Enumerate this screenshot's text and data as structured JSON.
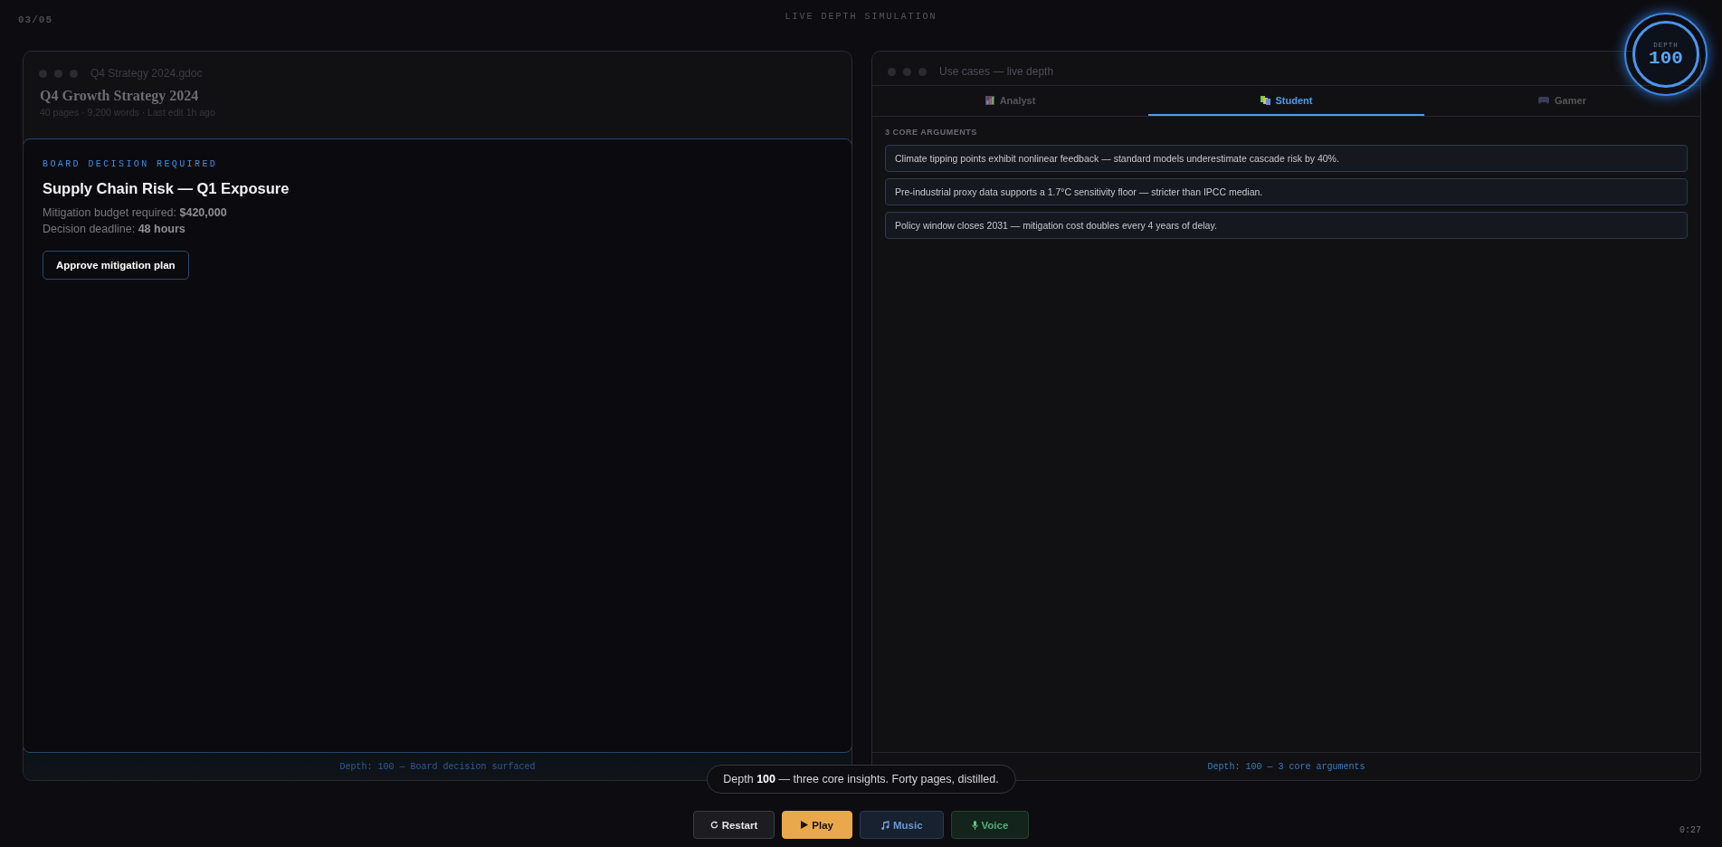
{
  "slide_counter": "03/05",
  "title": "LIVE DEPTH SIMULATION",
  "depth_badge": {
    "label": "DEPTH",
    "value": "100"
  },
  "left_window": {
    "filename": "Q4 Strategy 2024.gdoc",
    "doc_title": "Q4 Growth Strategy 2024",
    "meta": "40 pages · 9,200 words · Last edit 1h ago",
    "decision_card": {
      "eyebrow": "BOARD DECISION REQUIRED",
      "title": "Supply Chain Risk — Q1 Exposure",
      "lines": [
        "Mitigation budget required: **$420,000**",
        "Decision deadline: **48 hours**"
      ],
      "button": "Approve mitigation plan"
    },
    "footer": "Depth: 100 — Board decision surfaced"
  },
  "right_window": {
    "title": "Use cases — live depth",
    "tabs": [
      {
        "label": "Analyst",
        "kind": "chart",
        "selected": false
      },
      {
        "label": "Student",
        "kind": "books",
        "selected": true
      },
      {
        "label": "Gamer",
        "kind": "gamepad",
        "selected": false
      }
    ],
    "section_label": "3 CORE ARGUMENTS",
    "arguments": [
      "Climate tipping points exhibit nonlinear feedback — standard models underestimate cascade risk by 40%.",
      "Pre-industrial proxy data supports a 1.7°C sensitivity floor — stricter than IPCC median.",
      "Policy window closes 2031 — mitigation cost doubles every 4 years of delay."
    ],
    "footer": "Depth: 100 — 3 core arguments"
  },
  "caption": "Depth **100** — three core insights. Forty pages, distilled.",
  "controls": [
    {
      "label": "Restart",
      "kind": "restart"
    },
    {
      "label": "Play",
      "kind": "play"
    },
    {
      "label": "Music",
      "kind": "music"
    },
    {
      "label": "Voice",
      "kind": "voice"
    }
  ],
  "timer": "0:27"
}
